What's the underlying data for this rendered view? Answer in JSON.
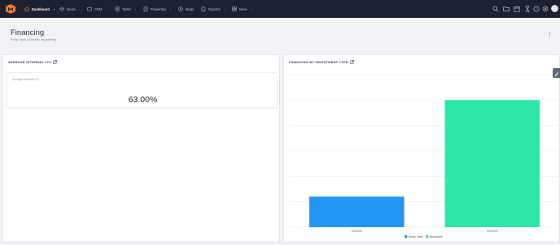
{
  "nav": {
    "items": [
      {
        "label": "Dashboard",
        "icon": "home-icon",
        "active": true
      },
      {
        "label": "Deals",
        "icon": "deals-icon"
      },
      {
        "label": "CRM",
        "icon": "crm-icon"
      },
      {
        "label": "Tasks",
        "icon": "tasks-icon"
      },
      {
        "label": "Properties",
        "icon": "properties-icon"
      },
      {
        "label": "Maps",
        "icon": "maps-icon"
      },
      {
        "label": "Reports",
        "icon": "reports-icon"
      },
      {
        "label": "More",
        "icon": "grid-icon"
      }
    ],
    "accent": "#f47b20"
  },
  "header": {
    "title": "Financing",
    "subtitle": "Keep track of what's happening."
  },
  "panels": {
    "ltc": {
      "title": "AVERAGE INTERNAL LTC",
      "card_label": "Average Internal LTC",
      "value": "63.00%"
    },
    "financing": {
      "title": "FINANCING BY INVESTMENT TYPE"
    }
  },
  "chart_data": {
    "type": "bar",
    "categories": [
      "1000000",
      "5000000"
    ],
    "series": [
      {
        "name": "Senior Debt",
        "color": "#2196f3",
        "values": [
          1200000,
          null
        ]
      },
      {
        "name": "Mezzanine",
        "color": "#2ee6a8",
        "values": [
          null,
          5000000
        ]
      }
    ],
    "ylim": [
      0,
      6000000
    ],
    "grid": true,
    "legend": "bottom-center"
  }
}
